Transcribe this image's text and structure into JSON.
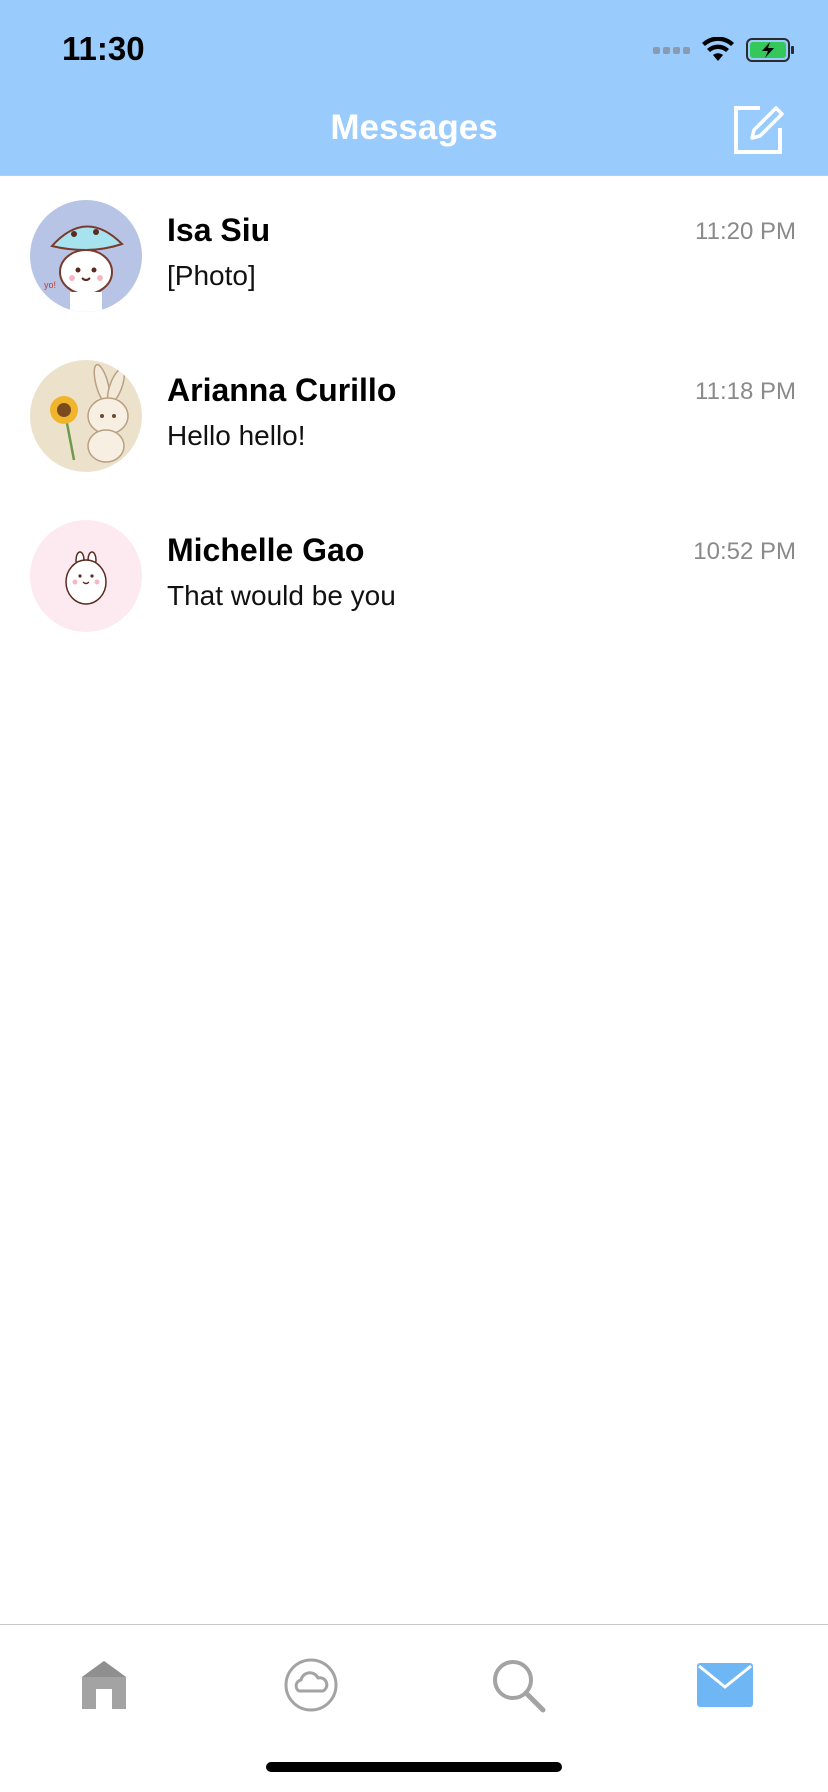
{
  "status_bar": {
    "time": "11:30"
  },
  "header": {
    "title": "Messages"
  },
  "conversations": [
    {
      "name": "Isa Siu",
      "preview": "[Photo]",
      "time": "11:20 PM",
      "avatar_label": "yo!"
    },
    {
      "name": "Arianna Curillo",
      "preview": "Hello hello!",
      "time": "11:18 PM"
    },
    {
      "name": "Michelle Gao",
      "preview": "That would be you",
      "time": "10:52 PM"
    }
  ],
  "tabbar": {
    "tabs": [
      {
        "icon": "home-icon",
        "active": false
      },
      {
        "icon": "cloud-icon",
        "active": false
      },
      {
        "icon": "search-icon",
        "active": false
      },
      {
        "icon": "mail-icon",
        "active": true
      }
    ]
  },
  "colors": {
    "header_bg": "#99cbfc",
    "active_tab": "#6fb6f5",
    "inactive_tab": "#a3a3a3"
  }
}
